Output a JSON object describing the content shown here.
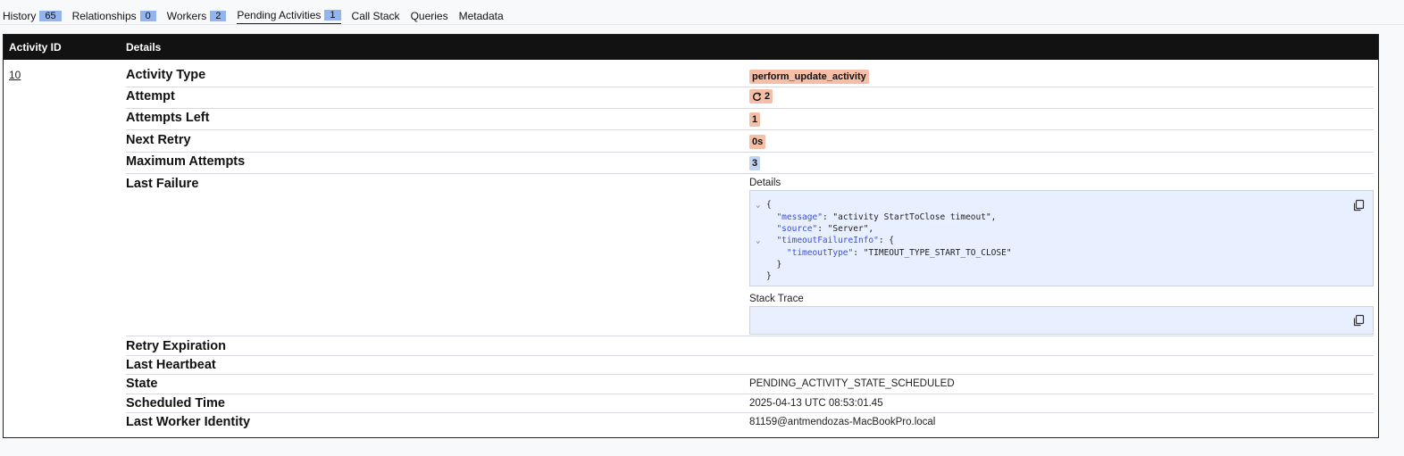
{
  "tabs": [
    {
      "label": "History",
      "count": "65"
    },
    {
      "label": "Relationships",
      "count": "0"
    },
    {
      "label": "Workers",
      "count": "2"
    },
    {
      "label": "Pending Activities",
      "count": "1"
    },
    {
      "label": "Call Stack"
    },
    {
      "label": "Queries"
    },
    {
      "label": "Metadata"
    }
  ],
  "table": {
    "headers": {
      "activity_id": "Activity ID",
      "details": "Details"
    },
    "activity_id": "10",
    "rows": {
      "activity_type": {
        "label": "Activity Type",
        "value": "perform_update_activity"
      },
      "attempt": {
        "label": "Attempt",
        "value": "2"
      },
      "attempts_left": {
        "label": "Attempts Left",
        "value": "1"
      },
      "next_retry": {
        "label": "Next Retry",
        "value": "0s"
      },
      "maximum_attempts": {
        "label": "Maximum Attempts",
        "value": "3"
      },
      "last_failure": {
        "label": "Last Failure",
        "details_label": "Details",
        "json_lines": [
          {
            "fold": "⌄",
            "text": "{"
          },
          {
            "key": "\"message\"",
            "text": ": \"activity StartToClose timeout\","
          },
          {
            "key": "\"source\"",
            "text": ": \"Server\","
          },
          {
            "fold": "⌄",
            "key": "\"timeoutFailureInfo\"",
            "text": ": {"
          },
          {
            "key": "\"timeoutType\"",
            "text": ": \"TIMEOUT_TYPE_START_TO_CLOSE\""
          },
          {
            "text": "}"
          },
          {
            "text": "}"
          }
        ],
        "stack_trace_label": "Stack Trace"
      },
      "retry_expiration": {
        "label": "Retry Expiration",
        "value": ""
      },
      "last_heartbeat": {
        "label": "Last Heartbeat",
        "value": ""
      },
      "state": {
        "label": "State",
        "value": "PENDING_ACTIVITY_STATE_SCHEDULED"
      },
      "scheduled_time": {
        "label": "Scheduled Time",
        "value": "2025-04-13 UTC 08:53:01.45"
      },
      "last_worker_identity": {
        "label": "Last Worker Identity",
        "value": "81159@antmendozas-MacBookPro.local"
      }
    }
  },
  "icons": {
    "copy": "copy-icon",
    "retry": "retry-icon",
    "fold": "chevron-down-icon"
  },
  "colors": {
    "badge": "#93b4ec",
    "warn_pill": "#f4bfa6",
    "info_pill": "#c3d4ef",
    "header": "#121212",
    "code_bg": "#e8efff"
  }
}
